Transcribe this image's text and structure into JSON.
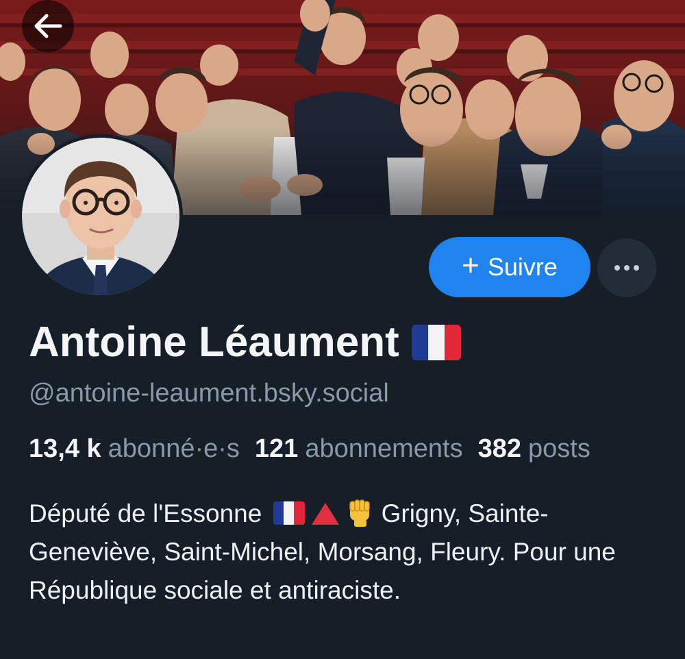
{
  "profile": {
    "display_name": "Antoine Léaument",
    "handle": "@antoine-leaument.bsky.social",
    "follow_label": "Suivre",
    "follow_plus": "+",
    "more_label": "•••",
    "stats": [
      {
        "value": "13,4 k",
        "label": "abonné·e·s"
      },
      {
        "value": "121",
        "label": "abonnements"
      },
      {
        "value": "382",
        "label": "posts"
      }
    ],
    "bio_line1_before": "Député de l'Essonne",
    "bio_line1_after": "Grigny,",
    "bio_rest": "Sainte-Geneviève, Saint-Michel, Morsang, Fleury. Pour une République sociale et antiraciste."
  },
  "icons": {
    "back": "arrow-left-icon",
    "more": "ellipsis-icon",
    "flag": "french-flag-emoji",
    "triangle": "red-triangle-emoji",
    "fist": "raised-fist-emoji"
  },
  "colors": {
    "background": "#161e27",
    "accent": "#1f84f0",
    "muted_text": "#8b98a8",
    "flag_blue": "#1f3b95",
    "flag_white": "#f4f4f4",
    "flag_red": "#e0283a"
  }
}
